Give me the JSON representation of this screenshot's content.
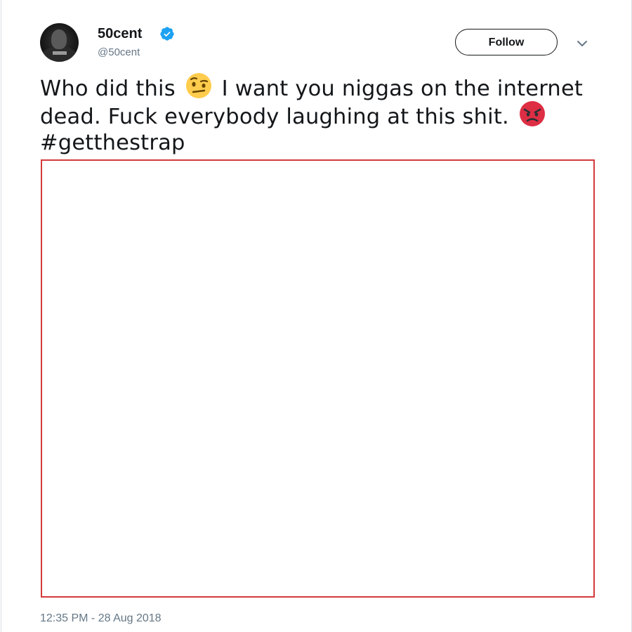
{
  "tweet": {
    "author": {
      "display_name": "50cent",
      "handle": "@50cent",
      "verified": true,
      "avatar_icon": "profile-photo"
    },
    "follow_label": "Follow",
    "menu_icon": "chevron-down-icon",
    "text": {
      "part1": "Who did this",
      "emoji1": "raised-eyebrow-emoji",
      "part2": "I want you niggas on the internet dead. Fuck everybody laughing at this shit.",
      "emoji2": "angry-face-emoji",
      "hashtag": "#getthestrap"
    },
    "timestamp": "12:35 PM - 28 Aug 2018"
  },
  "colors": {
    "text_primary": "#14171a",
    "text_secondary": "#657786",
    "verified_blue": "#1da1f2",
    "media_border": "#d43a3a"
  }
}
